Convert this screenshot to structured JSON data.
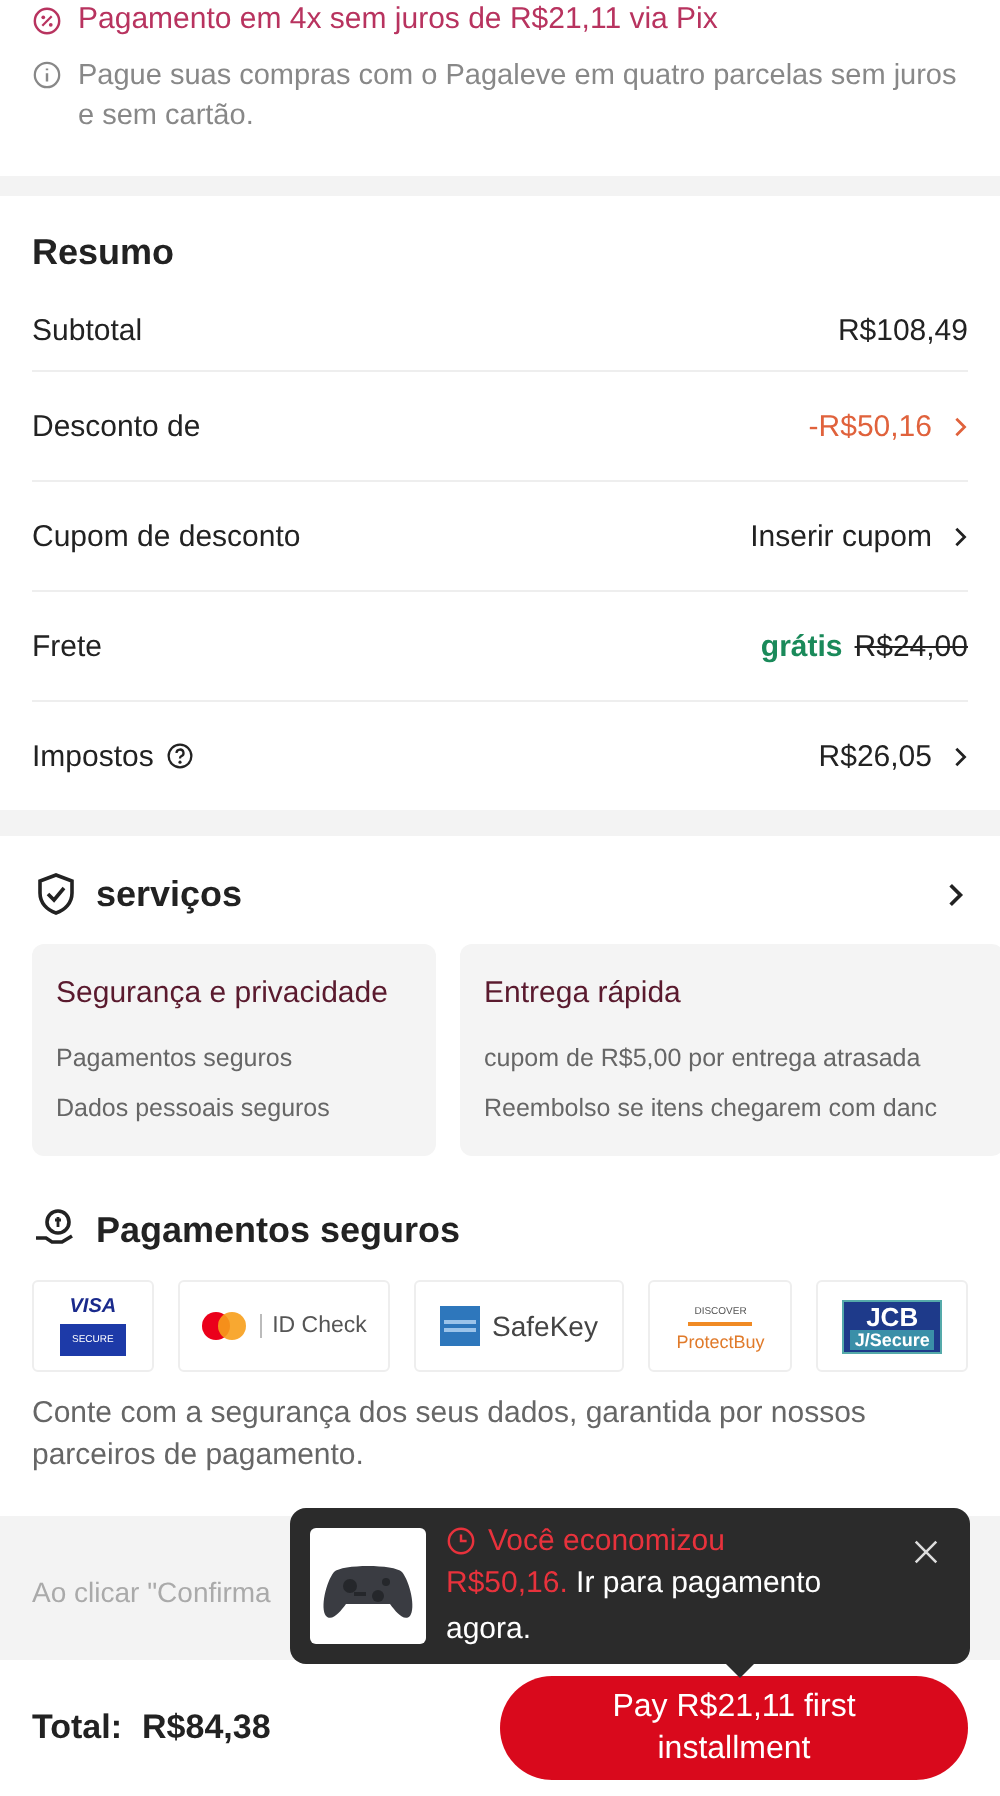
{
  "installments": {
    "promo": "Pagamento em 4x sem juros de R$21,11 via Pix",
    "info": "Pague suas compras com o Pagaleve em quatro parcelas sem juros e sem cartão."
  },
  "summary": {
    "title": "Resumo",
    "rows": [
      {
        "kind": "plain",
        "label": "Subtotal",
        "value": "R$108,49",
        "chevron": false
      },
      {
        "kind": "discount",
        "label": "Desconto de",
        "value": "-R$50,16",
        "chevron": true
      },
      {
        "kind": "plain",
        "label": "Cupom de desconto",
        "value": "Inserir cupom",
        "chevron": true
      },
      {
        "kind": "shipping",
        "label": "Frete",
        "value": "grátis",
        "old_value": "R$24,00",
        "chevron": false
      },
      {
        "kind": "help",
        "label": "Impostos",
        "value": "R$26,05",
        "chevron": true
      }
    ]
  },
  "services": {
    "title": "serviços",
    "cards": [
      {
        "title": "Segurança e privacidade",
        "lines": [
          "Pagamentos seguros",
          "Dados pessoais seguros"
        ]
      },
      {
        "title": "Entrega rápida",
        "lines": [
          "cupom de R$5,00 por entrega atrasada",
          "Reembolso se itens chegarem com danc"
        ]
      }
    ]
  },
  "payments": {
    "title": "Pagamentos seguros",
    "badges": [
      {
        "kind": "visa",
        "texts": [
          "VISA",
          "SECURE"
        ]
      },
      {
        "kind": "mastercard",
        "texts": [
          "ID Check"
        ]
      },
      {
        "kind": "amex",
        "texts": [
          "SafeKey"
        ]
      },
      {
        "kind": "discover",
        "texts": [
          "DISCOVER",
          "ProtectBuy"
        ]
      },
      {
        "kind": "jcb",
        "texts": [
          "JCB",
          "J/Secure"
        ]
      }
    ],
    "note": "Conte com a segurança dos seus dados, garantida por nossos parceiros de pagamento."
  },
  "disclaimer": "Ao clicar \"Confirma",
  "popup": {
    "title": "Você economizou",
    "amount": "R$50,16.",
    "message": "Ir para pagamento agora."
  },
  "footer": {
    "total_label": "Total:",
    "total": "R$84,38",
    "button": "Pay R$21,11 first installment"
  }
}
